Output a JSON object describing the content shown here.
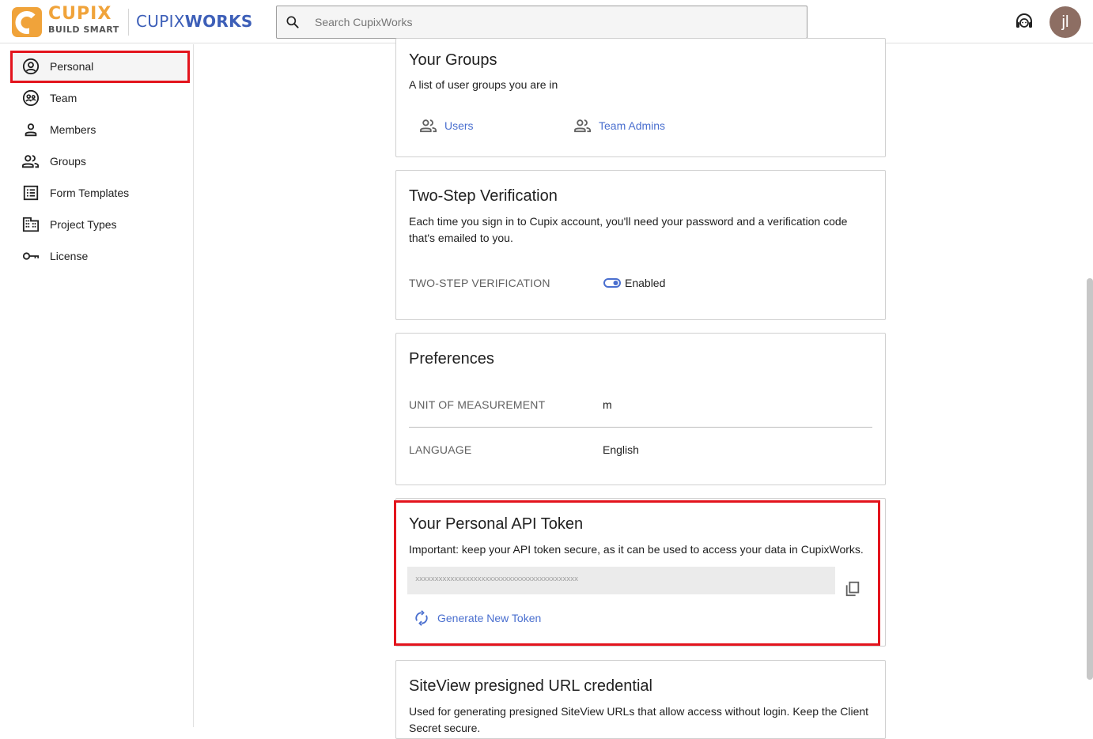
{
  "header": {
    "logo_name": "CUPIX",
    "logo_tagline": "BUILD SMART",
    "brand_light": "CUPIX",
    "brand_bold": "WORKS",
    "search_placeholder": "Search CupixWorks",
    "avatar_initials": "jl"
  },
  "sidebar": {
    "items": [
      {
        "label": "Personal",
        "icon": "account-circle-icon"
      },
      {
        "label": "Team",
        "icon": "team-icon"
      },
      {
        "label": "Members",
        "icon": "person-icon"
      },
      {
        "label": "Groups",
        "icon": "people-icon"
      },
      {
        "label": "Form Templates",
        "icon": "form-list-icon"
      },
      {
        "label": "Project Types",
        "icon": "building-icon"
      },
      {
        "label": "License",
        "icon": "key-icon"
      }
    ]
  },
  "groups": {
    "title": "Your Groups",
    "description": "A list of user groups you are in",
    "items": [
      "Users",
      "Team Admins"
    ]
  },
  "two_step": {
    "title": "Two-Step Verification",
    "description": "Each time you sign in to Cupix account, you'll need your password and a verification code that's emailed to you.",
    "label": "TWO-STEP VERIFICATION",
    "status": "Enabled"
  },
  "preferences": {
    "title": "Preferences",
    "unit_label": "UNIT OF MEASUREMENT",
    "unit_value": "m",
    "language_label": "LANGUAGE",
    "language_value": "English"
  },
  "api_token": {
    "title": "Your Personal API Token",
    "description": "Important: keep your API token secure, as it can be used to access your data in CupixWorks.",
    "token_masked": "xxxxxxxxxxxxxxxxxxxxxxxxxxxxxxxxxxxxxxxxxx",
    "generate_label": "Generate New Token"
  },
  "siteview": {
    "title": "SiteView presigned URL credential",
    "description": "Used for generating presigned SiteView URLs that allow access without login. Keep the Client Secret secure."
  },
  "colors": {
    "accent": "#4a6fcf",
    "brand_orange": "#f0a33a",
    "highlight_red": "#e3141d",
    "avatar_bg": "#8d6e63"
  }
}
